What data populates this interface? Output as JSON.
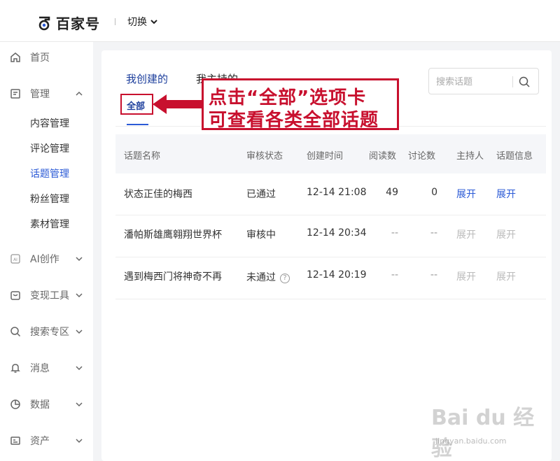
{
  "header": {
    "logo_text": "百家号",
    "switch_label": "切换"
  },
  "sidebar": {
    "items": [
      {
        "label": "首页",
        "icon": "home-icon"
      },
      {
        "label": "管理",
        "icon": "document-icon",
        "expanded": true
      },
      {
        "label": "AI创作",
        "icon": "ai-icon"
      },
      {
        "label": "变现工具",
        "icon": "wallet-icon"
      },
      {
        "label": "搜索专区",
        "icon": "search-icon"
      },
      {
        "label": "消息",
        "icon": "bell-icon"
      },
      {
        "label": "数据",
        "icon": "pie-chart-icon"
      },
      {
        "label": "资产",
        "icon": "card-icon"
      }
    ],
    "sub_items": [
      "内容管理",
      "评论管理",
      "话题管理",
      "粉丝管理",
      "素材管理"
    ],
    "active_sub": "话题管理"
  },
  "main": {
    "tabs": [
      "我创建的",
      "我主持的"
    ],
    "active_tab": "我创建的",
    "subtab": "全部",
    "search_placeholder": "搜索话题",
    "columns": [
      "话题名称",
      "审核状态",
      "创建时间",
      "阅读数",
      "讨论数",
      "主持人",
      "话题信息"
    ],
    "rows": [
      {
        "name": "状态正佳的梅西",
        "status": "已通过",
        "time": "12-14 21:08",
        "reads": "49",
        "discussions": "0",
        "host": "展开",
        "info": "展开",
        "enabled": true
      },
      {
        "name": "潘帕斯雄鹰翱翔世界杯",
        "status": "审核中",
        "time": "12-14 20:34",
        "reads": "--",
        "discussions": "--",
        "host": "展开",
        "info": "展开",
        "enabled": false
      },
      {
        "name": "遇到梅西门将神奇不再",
        "status": "未通过",
        "time": "12-14 20:19",
        "reads": "--",
        "discussions": "--",
        "host": "展开",
        "info": "展开",
        "enabled": false
      }
    ],
    "help_glyph": "?"
  },
  "annotation": {
    "line1": "点击“全部”选项卡",
    "line2": "可查看各类全部话题",
    "color": "#c8102e"
  },
  "watermark": {
    "text": "Bai du 经验",
    "url": "jingyan.baidu.com"
  },
  "colors": {
    "accent": "#2b5ad6",
    "annotation_red": "#c8102e",
    "disabled": "#bbbbbb"
  }
}
